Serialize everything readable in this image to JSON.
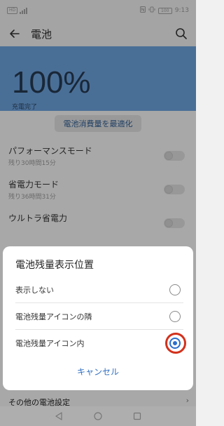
{
  "status_bar": {
    "sim_label": "HD",
    "battery_label": "100",
    "time": "9:13"
  },
  "header": {
    "title": "電池"
  },
  "battery": {
    "percent": "100%",
    "status": "充電完了"
  },
  "optimize_button": "電池消費量を最適化",
  "settings": [
    {
      "title": "パフォーマンスモード",
      "subtitle": "残り30時間15分"
    },
    {
      "title": "省電力モード",
      "subtitle": "残り36時間31分"
    },
    {
      "title": "ウルトラ省電力",
      "subtitle": ""
    }
  ],
  "dialog": {
    "title": "電池残量表示位置",
    "options": [
      {
        "label": "表示しない",
        "selected": false
      },
      {
        "label": "電池残量アイコンの隣",
        "selected": false
      },
      {
        "label": "電池残量アイコン内",
        "selected": true
      }
    ],
    "cancel_label": "キャンセル"
  },
  "bottom_item": "その他の電池設定",
  "colors": {
    "accent_blue": "#2a6fcc",
    "hero_blue": "#6b9fd8",
    "highlight_red": "#d2311c"
  }
}
